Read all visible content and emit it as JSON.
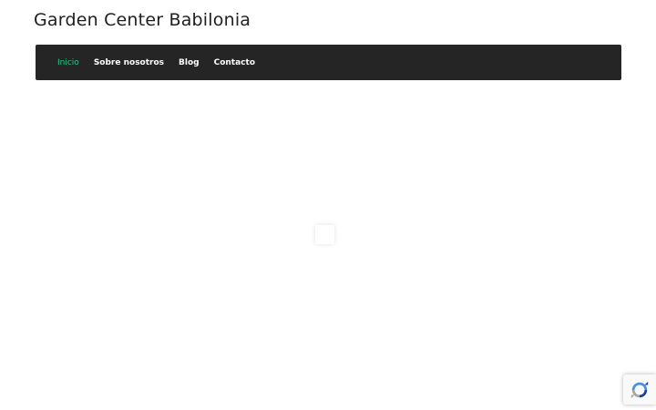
{
  "site": {
    "title": "Garden Center Babilonia"
  },
  "nav": {
    "items": [
      {
        "label": "Inicio",
        "active": true
      },
      {
        "label": "Sobre nosotros",
        "active": false
      },
      {
        "label": "Blog",
        "active": false
      },
      {
        "label": "Contacto",
        "active": false
      }
    ]
  },
  "colors": {
    "accent": "#2fc48d",
    "navbar_bg": "#252525",
    "title_text": "#1e1e1e"
  },
  "icons": {
    "recaptcha": "recaptcha-icon"
  }
}
